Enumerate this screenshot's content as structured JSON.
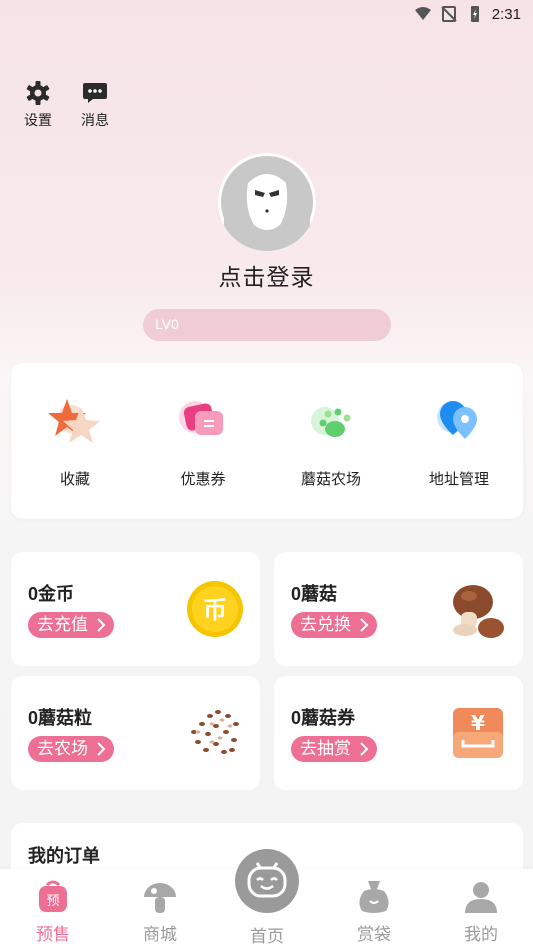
{
  "status_bar": {
    "time": "2:31"
  },
  "top_actions": {
    "settings_label": "设置",
    "messages_label": "消息"
  },
  "profile": {
    "login_prompt": "点击登录",
    "level": "LV0"
  },
  "quick_entries": [
    {
      "label": "收藏",
      "icon": "star-icon"
    },
    {
      "label": "优惠券",
      "icon": "coupon-icon"
    },
    {
      "label": "蘑菇农场",
      "icon": "paw-icon"
    },
    {
      "label": "地址管理",
      "icon": "location-pin-icon"
    }
  ],
  "assets": [
    {
      "title": "0金币",
      "button": "去充值",
      "icon": "coin-icon"
    },
    {
      "title": "0蘑菇",
      "button": "去兑换",
      "icon": "mushroom-icon"
    },
    {
      "title": "0蘑菇粒",
      "button": "去农场",
      "icon": "seeds-icon"
    },
    {
      "title": "0蘑菇券",
      "button": "去抽赏",
      "icon": "voucher-icon"
    }
  ],
  "orders": {
    "title": "我的订单"
  },
  "tabbar": {
    "items": [
      {
        "label": "预售",
        "icon": "presale-bag-icon"
      },
      {
        "label": "商城",
        "icon": "mushroom-shop-icon"
      },
      {
        "label": "首页",
        "icon": "home-robot-icon"
      },
      {
        "label": "赏袋",
        "icon": "reward-bag-icon"
      },
      {
        "label": "我的",
        "icon": "user-icon"
      }
    ],
    "active": "预售"
  },
  "colors": {
    "accent": "#ee6f94",
    "level_bar": "#f0ccd6",
    "inactive_tab": "#9b9b9b"
  }
}
